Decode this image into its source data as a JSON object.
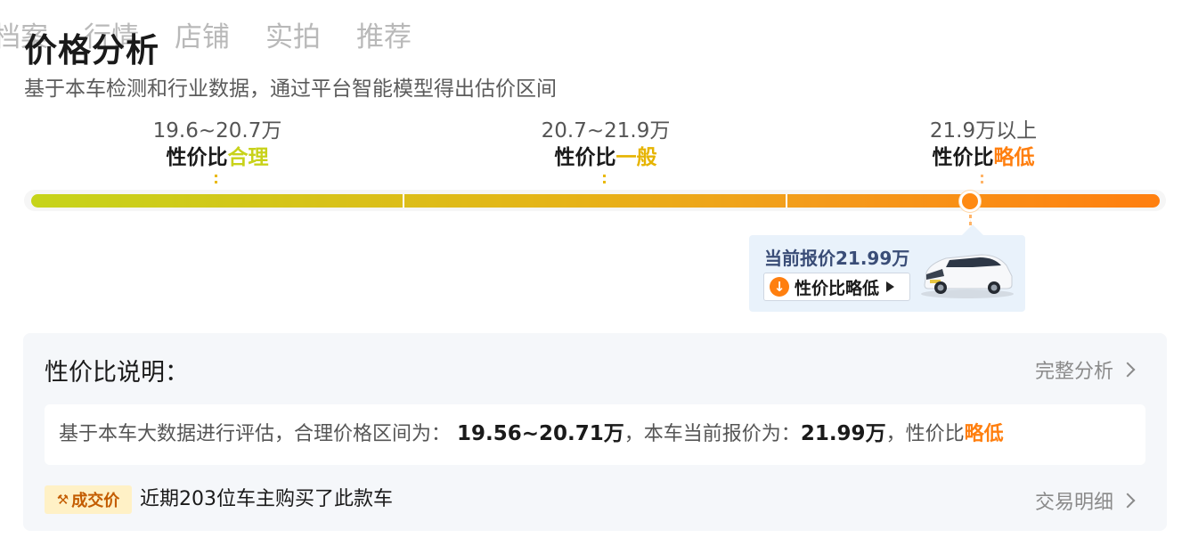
{
  "top_tabs": [
    "档案",
    "行情",
    "店铺",
    "实拍",
    "推荐"
  ],
  "title": "价格分析",
  "subtitle": "基于本车检测和行业数据，通过平台智能模型得出估价区间",
  "ranges": [
    {
      "price": "19.6~20.7万",
      "label_prefix": "性价比",
      "label_value": "合理",
      "color": "#c8d21a"
    },
    {
      "price": "20.7~21.9万",
      "label_prefix": "性价比",
      "label_value": "一般",
      "color": "#e6b400"
    },
    {
      "price": "21.9万以上",
      "label_prefix": "性价比",
      "label_value": "略低",
      "color": "#ff7f0f"
    }
  ],
  "current": {
    "price_text": "当前报价21.99万",
    "badge_text": "性价比略低",
    "badge_icon": "down-arrow-icon",
    "car_image": "white-mpv-car-image"
  },
  "explain": {
    "title": "性价比说明：",
    "full_analysis_link": "完整分析",
    "text_prefix": "基于本车大数据进行评估，合理价格区间为：",
    "range_value": "19.56~20.71万",
    "text_mid": "，本车当前报价为：",
    "current_value": "21.99万",
    "text_suffix": "，性价比",
    "rating": "略低"
  },
  "deal": {
    "badge": "成交价",
    "badge_icon": "hammer-icon",
    "text": "近期203位车主购买了此款车",
    "detail_link": "交易明细"
  },
  "colors": {
    "accent_orange": "#ff7f0f",
    "panel_bg": "#f5f7fa",
    "bubble_bg": "#e9f2fb"
  }
}
